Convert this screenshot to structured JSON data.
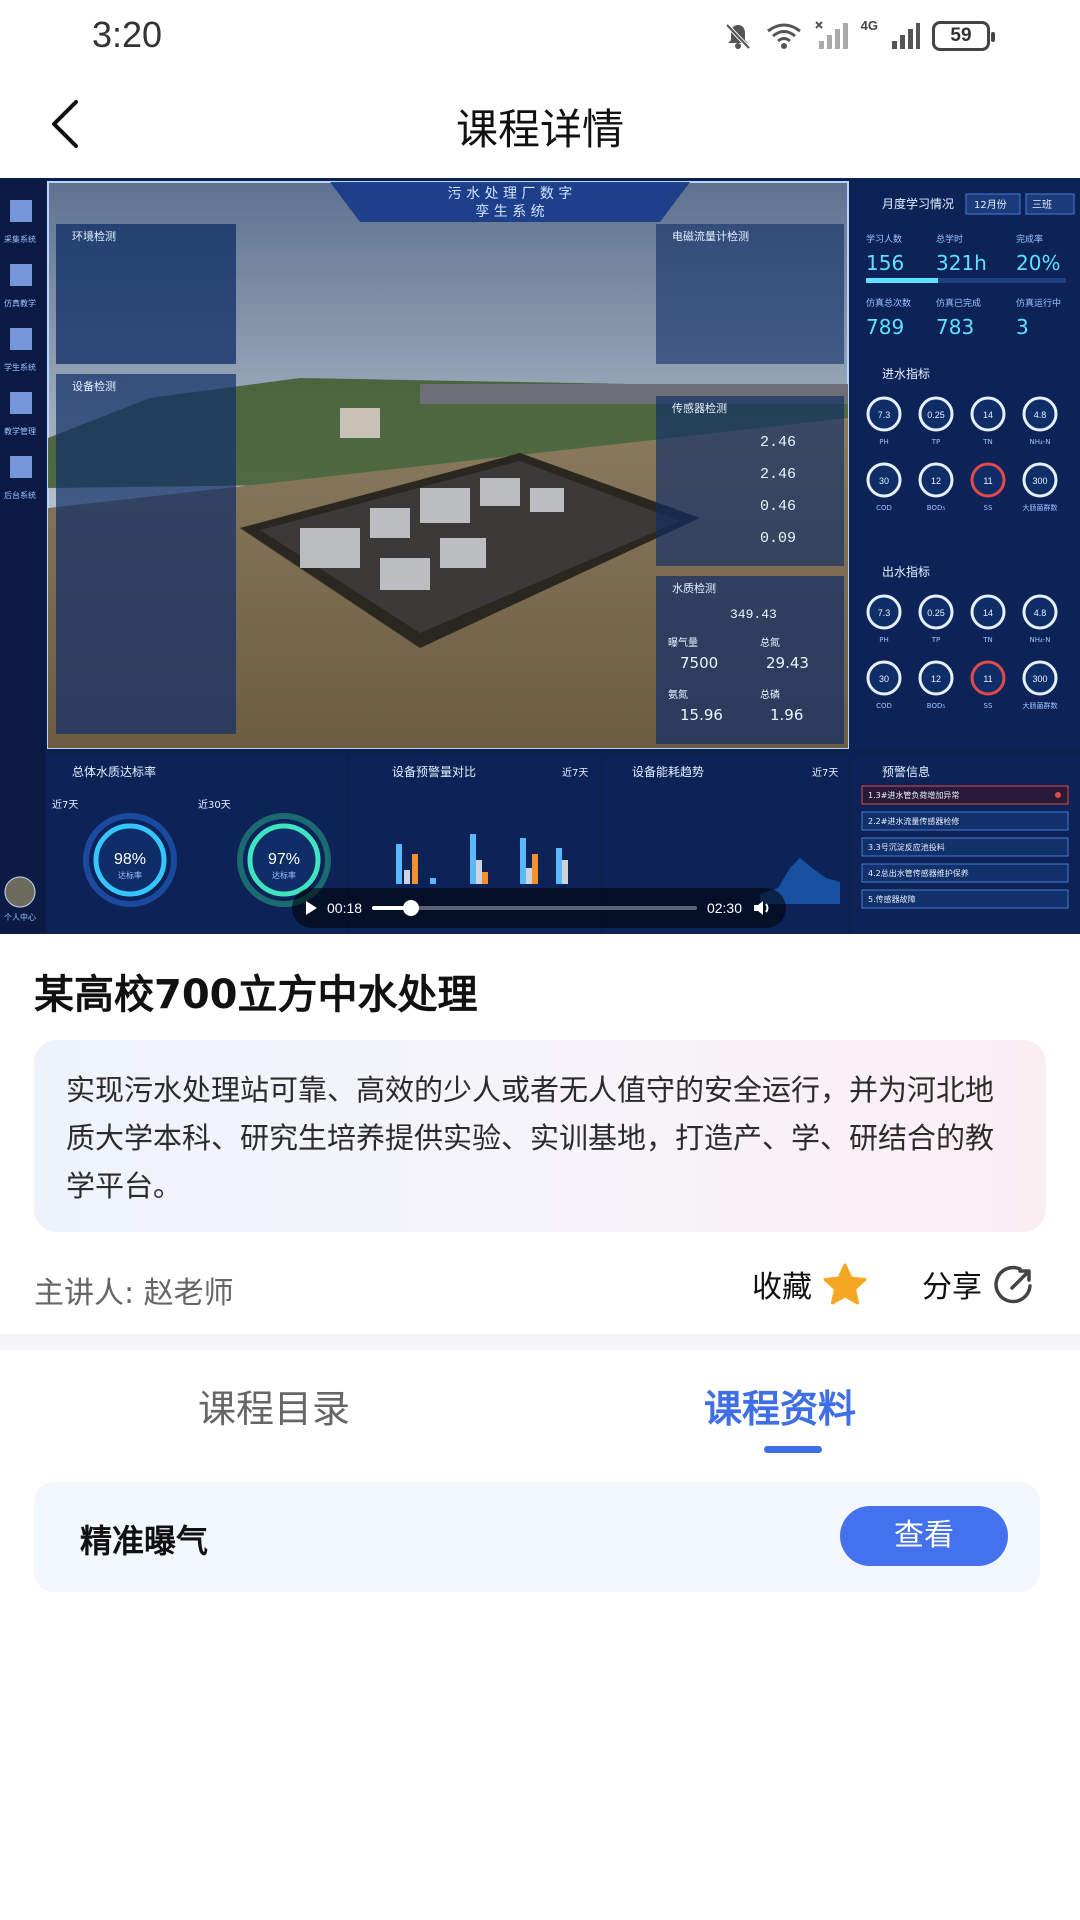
{
  "status_bar": {
    "time": "3:20",
    "battery": "59",
    "network": "4G"
  },
  "nav": {
    "title": "课程详情"
  },
  "video": {
    "current_time": "00:18",
    "duration": "02:30",
    "progress": 0.12,
    "screen": {
      "title_line1": "污 水 处 理 厂 数 字",
      "title_line2": "孪 生 系 统",
      "side_menu": [
        "采集系统",
        "仿真教学",
        "学生系统",
        "教学管理",
        "后台系统"
      ],
      "profile_label": "个人中心",
      "panel_env": "环境检测",
      "panel_equip": "设备检测",
      "panel_flow": "电磁流量计检测",
      "panel_sensor": "传感器检测",
      "panel_water": "水质检测",
      "monthly": {
        "title": "月度学习情况",
        "month": "12月份",
        "class": "三班",
        "stats": [
          {
            "label": "学习人数",
            "value": "156"
          },
          {
            "label": "总学时",
            "value": "321h"
          },
          {
            "label": "完成率",
            "value": "20%"
          },
          {
            "label": "仿真总次数",
            "value": "789"
          },
          {
            "label": "仿真已完成",
            "value": "783"
          },
          {
            "label": "仿真运行中",
            "value": "3"
          }
        ]
      },
      "inflow_title": "进水指标",
      "outflow_title": "出水指标",
      "gauge_values": [
        "7.3",
        "0.25",
        "14",
        "4.8",
        "30",
        "12",
        "11",
        "300"
      ],
      "gauge_labels": [
        "PH",
        "TP",
        "TN",
        "NH₄-N",
        "COD",
        "BOD₅",
        "SS",
        "大肠菌群数"
      ],
      "sensor_values": [
        "2.46",
        "2.46",
        "0.46",
        "0.09"
      ],
      "water_values": [
        {
          "label": "曝气量",
          "value": "7500"
        },
        {
          "label": "总氮",
          "value": "29.43"
        },
        {
          "label": "氨氮",
          "value": "15.96"
        },
        {
          "label": "总磷",
          "value": "1.96"
        }
      ],
      "suspended": "349.43",
      "bottom": {
        "quality": {
          "title": "总体水质达标率",
          "p7_label": "近7天",
          "p7": "98%",
          "p30_label": "近30天",
          "p30": "97%",
          "unit": "达标率"
        },
        "compare": {
          "title": "设备预警量对比",
          "range": "近7天"
        },
        "energy": {
          "title": "设备能耗趋势",
          "range": "近7天"
        },
        "alerts": {
          "title": "预警信息",
          "items": [
            "1.3#进水管负荷增加异常",
            "2.2#进水流量传感器检修",
            "3.3号沉淀反应池投料",
            "4.2总出水管传感器维护保养",
            "5.传感器故障"
          ]
        }
      }
    }
  },
  "course": {
    "title": "某高校700立方中水处理",
    "description": "实现污水处理站可靠、高效的少人或者无人值守的安全运行，并为河北地质大学本科、研究生培养提供实验、实训基地，打造产、学、研结合的教学平台。",
    "lecturer": "主讲人: 赵老师",
    "favorite_label": "收藏",
    "share_label": "分享"
  },
  "tabs": [
    {
      "label": "课程目录",
      "active": false
    },
    {
      "label": "课程资料",
      "active": true
    }
  ],
  "materials": [
    {
      "name": "精准曝气",
      "action": "查看"
    }
  ],
  "colors": {
    "accent": "#3f6fe6",
    "button": "#4472ef",
    "star": "#f5a623"
  }
}
